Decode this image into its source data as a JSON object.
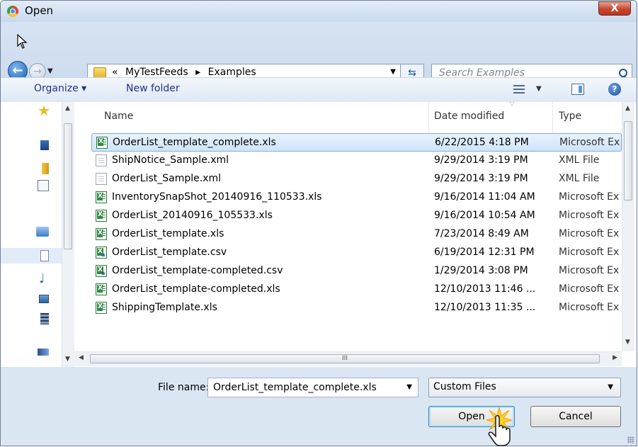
{
  "window": {
    "title": "Open",
    "close_label": "X"
  },
  "nav": {
    "breadcrumb_prefix": "«",
    "breadcrumb": [
      "MyTestFeeds",
      "Examples"
    ],
    "separator": "▸",
    "search_placeholder": "Search Examples"
  },
  "toolbar": {
    "organize": "Organize ▾",
    "new_folder": "New folder"
  },
  "columns": {
    "name": "Name",
    "date": "Date modified",
    "type": "Type"
  },
  "files": [
    {
      "name": "OrderList_template_complete.xls",
      "date": "6/22/2015 4:18 PM",
      "type": "Microsoft Ex",
      "icon": "xls-file-icon",
      "selected": true
    },
    {
      "name": "ShipNotice_Sample.xml",
      "date": "9/29/2014 3:19 PM",
      "type": "XML File",
      "icon": "xml-file-icon"
    },
    {
      "name": "OrderList_Sample.xml",
      "date": "9/29/2014 3:19 PM",
      "type": "XML File",
      "icon": "xml-file-icon"
    },
    {
      "name": "InventorySnapShot_20140916_110533.xls",
      "date": "9/16/2014 11:04 AM",
      "type": "Microsoft Ex",
      "icon": "xls-file-icon"
    },
    {
      "name": "OrderList_20140916_105533.xls",
      "date": "9/16/2014 10:54 AM",
      "type": "Microsoft Ex",
      "icon": "xls-file-icon"
    },
    {
      "name": "OrderList_template.xls",
      "date": "7/23/2014 8:49 AM",
      "type": "Microsoft Ex",
      "icon": "xls-file-icon"
    },
    {
      "name": "OrderList_template.csv",
      "date": "6/19/2014 12:31 PM",
      "type": "Microsoft Ex",
      "icon": "csv-file-icon"
    },
    {
      "name": "OrderList_template-completed.csv",
      "date": "1/29/2014 3:08 PM",
      "type": "Microsoft Ex",
      "icon": "csv-file-icon"
    },
    {
      "name": "OrderList_template-completed.xls",
      "date": "12/10/2013 11:46 ...",
      "type": "Microsoft Ex",
      "icon": "xls-file-icon"
    },
    {
      "name": "ShippingTemplate.xls",
      "date": "12/10/2013 11:35 ...",
      "type": "Microsoft Ex",
      "icon": "xls-file-icon"
    }
  ],
  "footer": {
    "file_name_label": "File name:",
    "file_name_value": "OrderList_template_complete.xls",
    "file_type": "Custom Files",
    "open_label": "Open",
    "cancel_label": "Cancel"
  }
}
